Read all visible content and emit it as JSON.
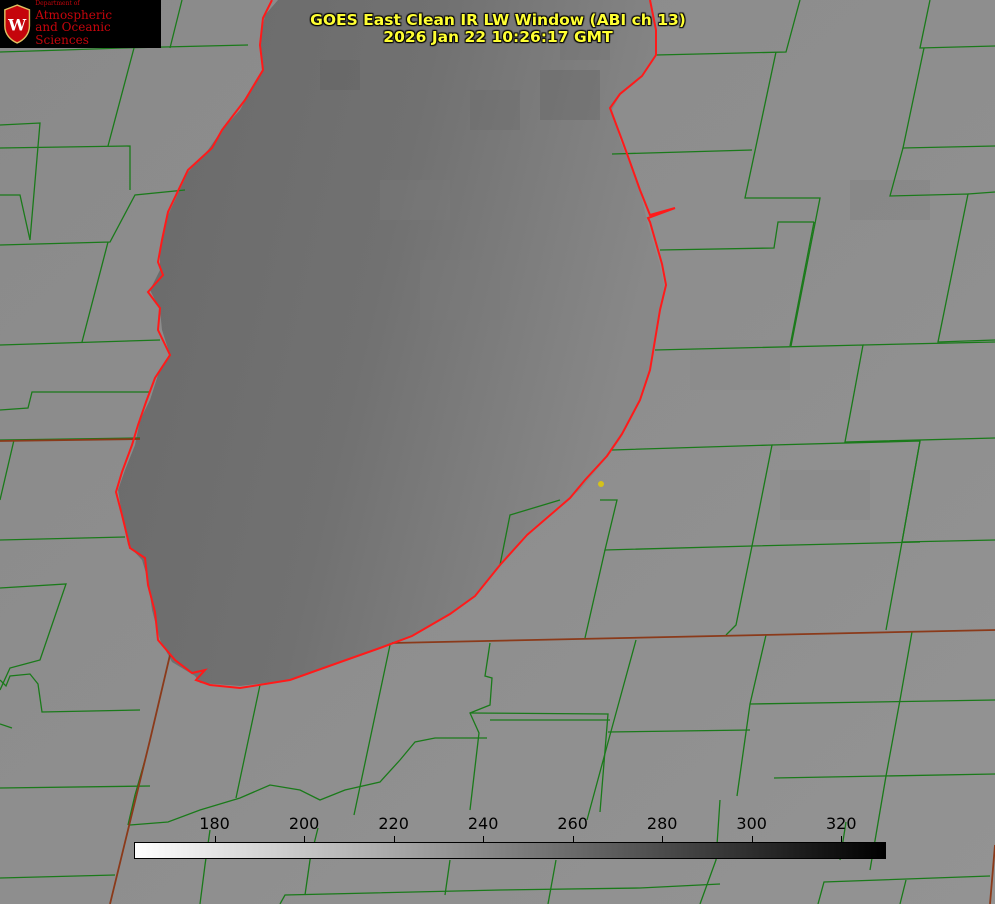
{
  "title": {
    "line1": "GOES East Clean IR LW Window (ABI ch 13)",
    "line2": "2026 Jan 22 10:26:17 GMT"
  },
  "logo": {
    "dept": "Department of",
    "line1": "Atmospheric",
    "line2": "and Oceanic Sciences",
    "seal_letter": "W"
  },
  "colorbar": {
    "min": 162,
    "max": 330,
    "ticks": [
      "180",
      "200",
      "220",
      "240",
      "260",
      "280",
      "300",
      "320"
    ],
    "gradient": [
      "#ffffff",
      "#000000"
    ]
  },
  "colors": {
    "background": "#8c8c8c",
    "lake": "#6e6e6e",
    "county_lines": "#1a7a1a",
    "state_lines": "#8b3a1a",
    "shoreline": "#ff1a1a",
    "title": "#ffff33",
    "logo_red": "#c5050c",
    "marker": "#d4c21a"
  }
}
